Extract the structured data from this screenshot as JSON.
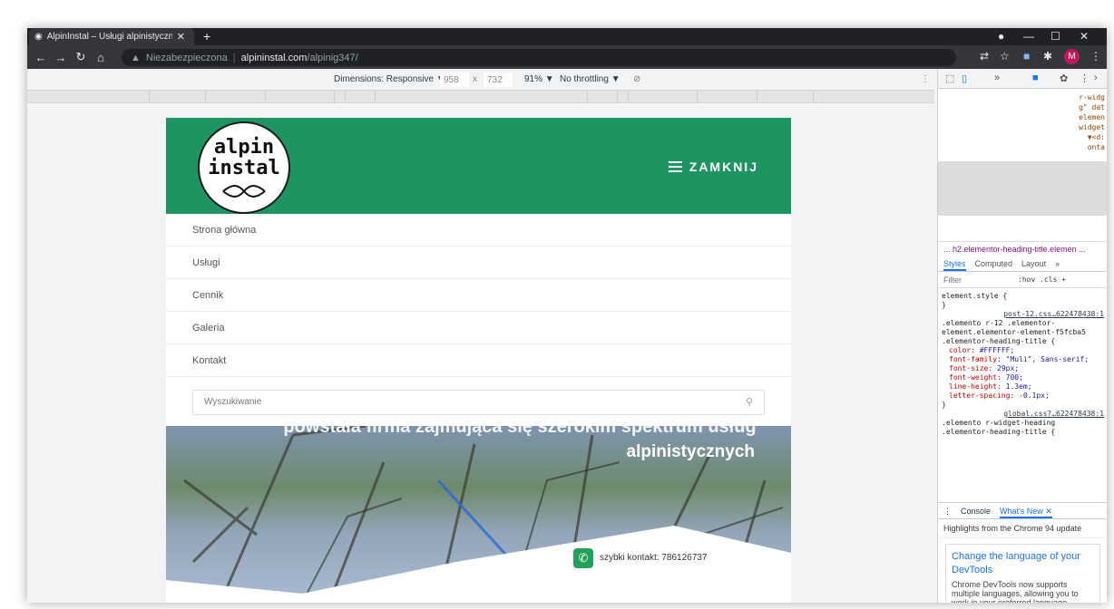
{
  "browser": {
    "tab_title": "AlpinInstal – Usługi alpinistyczne",
    "tab_close": "✕",
    "new_tab": "+",
    "security_label": "Niezabezpieczona",
    "url_host": "alpininstal.com",
    "url_path": "/alpinig347/",
    "avatar_letter": "M"
  },
  "device_toolbar": {
    "dimensions_label": "Dimensions: Responsive ▼",
    "width": "958",
    "times": "x",
    "height": "732",
    "zoom": "91% ▼",
    "throttling": "No throttling ▼"
  },
  "site": {
    "logo_line1": "alpin",
    "logo_line2": "instal",
    "menu_toggle_label": "ZAMKNIJ",
    "menu_items": [
      "Strona główna",
      "Usługi",
      "Cennik",
      "Galeria",
      "Kontakt"
    ],
    "search_placeholder": "Wyszukiwanie",
    "hero_line1": "powstała firma zajmująca się szerokim spektrum usług",
    "hero_line2": "alpinistycznych",
    "quick_contact": "szybki kontakt: 786126737"
  },
  "devtools": {
    "elements_lines": [
      "r-widg",
      "g\" dat",
      "elemen",
      "widget",
      "▼<d:",
      "onta"
    ],
    "breadcrumb": "... h2.elementor-heading-title.elemen ...",
    "styles_tabs": [
      "Styles",
      "Computed",
      "Layout",
      "»"
    ],
    "filter_placeholder": "Filter",
    "filter_tools": ":hov .cls +",
    "rule1": "element.style {",
    "rule1_end": "}",
    "rule2_selector": ".elemento r-12 .elementor-element.elementor-element-f5fcba5 .elementor-heading-title {",
    "rule2_source": "post-12.css…622478438:1",
    "props": [
      {
        "name": "color",
        "value": "#FFFFFF;"
      },
      {
        "name": "font-family",
        "value": "\"Muli\", Sans-serif;"
      },
      {
        "name": "font-size",
        "value": "29px;"
      },
      {
        "name": "font-weight",
        "value": "700;"
      },
      {
        "name": "line-height",
        "value": "1.3em;"
      },
      {
        "name": "letter-spacing",
        "value": "-0.1px;"
      }
    ],
    "rule2_end": "}",
    "rule3_selector": ".elemento r-widget-heading .elementor-heading-title {",
    "rule3_source": "global.css?…622478438:1",
    "drawer_tabs": [
      "Console",
      "What's New ✕"
    ],
    "highlights": "Highlights from the Chrome 94 update",
    "card_title": "Change the language of your DevTools",
    "card_body": "Chrome DevTools now supports multiple languages, allowing you to work in your preferred language."
  }
}
